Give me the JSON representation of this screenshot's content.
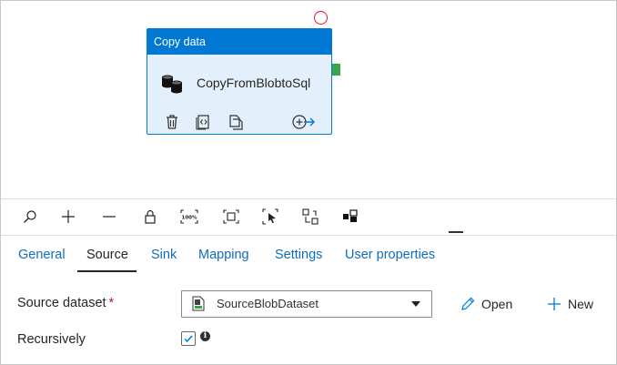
{
  "activity": {
    "type_label": "Copy data",
    "name": "CopyFromBlobtoSql"
  },
  "tabs": [
    {
      "label": "General",
      "active": false
    },
    {
      "label": "Source",
      "active": true
    },
    {
      "label": "Sink",
      "active": false
    },
    {
      "label": "Mapping",
      "active": false
    },
    {
      "label": "Settings",
      "active": false
    },
    {
      "label": "User properties",
      "active": false
    }
  ],
  "toolbar": {
    "zoom_level_label": "100%"
  },
  "source": {
    "dataset_label": "Source dataset",
    "required_mark": "*",
    "dataset_value": "SourceBlobDataset",
    "open_label": "Open",
    "new_label": "New",
    "recursively_label": "Recursively",
    "recursively_checked": true
  },
  "colors": {
    "accent": "#0078d4",
    "link": "#0f6cbd",
    "success_port": "#3aa547",
    "error": "#e81123",
    "node_background": "#e3f0fb"
  }
}
